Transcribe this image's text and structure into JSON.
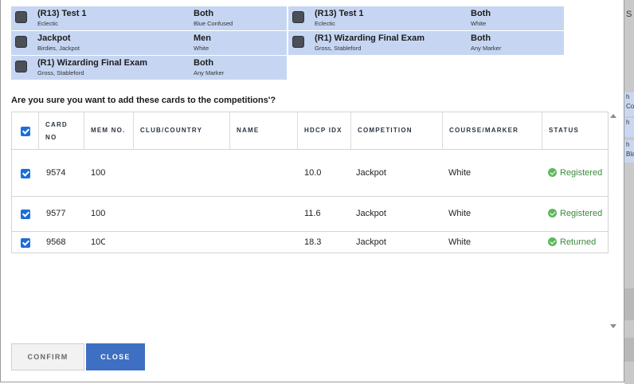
{
  "competitions": [
    {
      "name": "(R13) Test 1",
      "formats": "Eclectic",
      "gender": "Both",
      "marker": "Blue Confused"
    },
    {
      "name": "(R13) Test 1",
      "formats": "Eclectic",
      "gender": "Both",
      "marker": "White"
    },
    {
      "name": "Jackpot",
      "formats": "Birdies, Jackpot",
      "gender": "Men",
      "marker": "White"
    },
    {
      "name": "(R1) Wizarding Final Exam",
      "formats": "Gross, Stableford",
      "gender": "Both",
      "marker": "Any Marker"
    },
    {
      "name": "(R1) Wizarding Final Exam",
      "formats": "Gross, Stableford",
      "gender": "Both",
      "marker": "Any Marker"
    }
  ],
  "question": "Are you sure you want to add these cards to the competitions'?",
  "table": {
    "headers": {
      "card_no_1": "Card",
      "card_no_2": "No",
      "mem_no": "Mem No.",
      "club": "Club/Country",
      "name": "Name",
      "hdcp": "HDCP IDX",
      "competition": "Competition",
      "course": "Course/Marker",
      "status": "Status"
    },
    "rows": [
      {
        "card_no": "9574",
        "mem_no": "100",
        "club": "",
        "name": "",
        "hdcp": "10.0",
        "competition": "Jackpot",
        "course": "White",
        "status": "Registered"
      },
      {
        "card_no": "9577",
        "mem_no": "100",
        "club": "",
        "name": "",
        "hdcp": "11.6",
        "competition": "Jackpot",
        "course": "White",
        "status": "Registered"
      },
      {
        "card_no": "9568",
        "mem_no": "10C",
        "club": "",
        "name": "",
        "hdcp": "18.3",
        "competition": "Jackpot",
        "course": "White",
        "status": "Returned"
      }
    ]
  },
  "buttons": {
    "confirm": "Confirm",
    "close": "Close"
  },
  "background": {
    "letter": "S",
    "strip1a": "h",
    "strip1b": "Co",
    "strip2a": "h",
    "strip3a": "h",
    "strip3b": "Bla"
  },
  "colors": {
    "card_bg": "#c6d6f2",
    "accent": "#3e6fc2",
    "success": "#5cb85c",
    "checkbox": "#1a6fd8"
  },
  "icons": {
    "check": "check-icon",
    "status": "check-circle-icon",
    "scroll_up": "caret-up-icon",
    "scroll_down": "caret-down-icon"
  }
}
